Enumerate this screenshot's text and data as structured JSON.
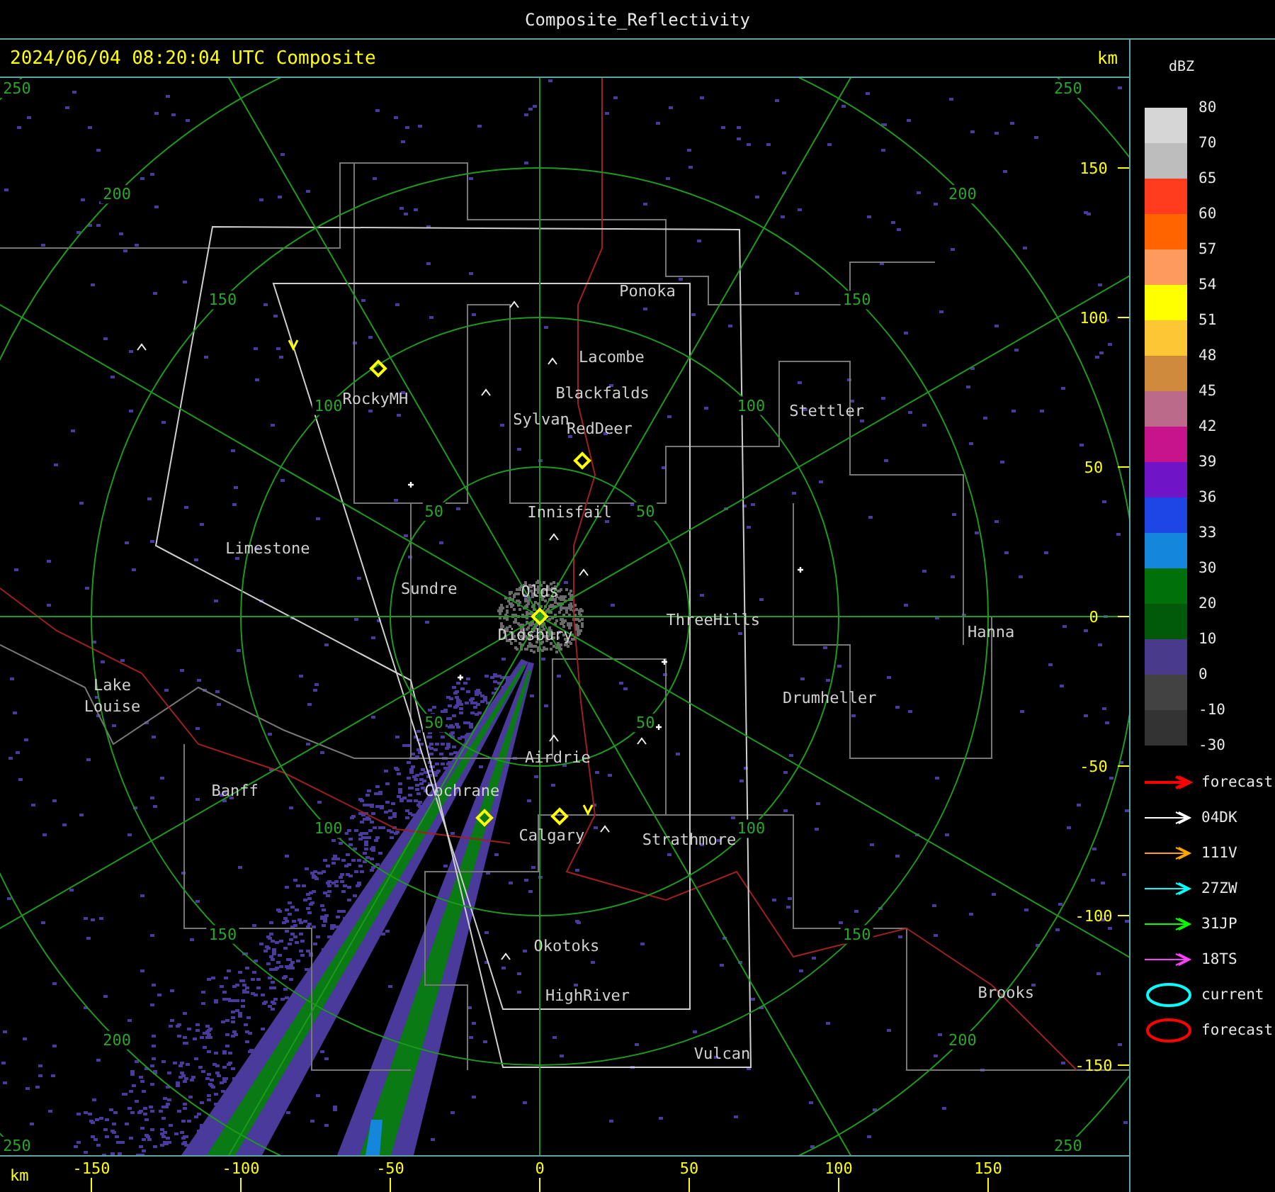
{
  "window": {
    "title": "Composite_Reflectivity"
  },
  "map": {
    "timestamp": "2024/06/04 08:20:04 UTC Composite",
    "unit": "km",
    "rings": [
      {
        "labels": [
          "50",
          "50",
          "50",
          "50"
        ]
      },
      {
        "labels": [
          "100",
          "100",
          "100",
          "100"
        ]
      },
      {
        "labels": [
          "150",
          "150",
          "150",
          "150"
        ]
      },
      {
        "labels": [
          "200",
          "200",
          "200",
          "200"
        ]
      },
      {
        "labels": [
          "250",
          "250",
          "250",
          "250"
        ]
      }
    ],
    "cities": [
      {
        "name": "Ponoka"
      },
      {
        "name": "Lacombe"
      },
      {
        "name": "Blackfalds"
      },
      {
        "name": "RedDeer"
      },
      {
        "name": "Sylvan"
      },
      {
        "name": "RockyMH"
      },
      {
        "name": "Stettler"
      },
      {
        "name": "Limestone"
      },
      {
        "name": "Innisfail"
      },
      {
        "name": "Sundre"
      },
      {
        "name": "Olds"
      },
      {
        "name": "Didsbury"
      },
      {
        "name": "ThreeHills"
      },
      {
        "name": "Hanna"
      },
      {
        "name": "Drumheller"
      },
      {
        "name": "Lake Louise"
      },
      {
        "name": "Banff"
      },
      {
        "name": "Cochrane"
      },
      {
        "name": "Airdrie"
      },
      {
        "name": "Calgary"
      },
      {
        "name": "Strathmore"
      },
      {
        "name": "Okotoks"
      },
      {
        "name": "HighRiver"
      },
      {
        "name": "Vulcan"
      },
      {
        "name": "Brooks"
      }
    ],
    "y_ticks": [
      "150",
      "100",
      "50",
      "0",
      "-50",
      "-100",
      "-150"
    ]
  },
  "x_axis": {
    "unit": "km",
    "ticks": [
      "-150",
      "-100",
      "-50",
      "0",
      "50",
      "100",
      "150"
    ]
  },
  "legend": {
    "unit": "dBZ",
    "levels": [
      {
        "label": "80",
        "color": "#d6d6d6"
      },
      {
        "label": "70",
        "color": "#bdbdbd"
      },
      {
        "label": "65",
        "color": "#ff3c1e"
      },
      {
        "label": "60",
        "color": "#ff6400"
      },
      {
        "label": "57",
        "color": "#ff9a5e"
      },
      {
        "label": "54",
        "color": "#ffff00"
      },
      {
        "label": "51",
        "color": "#fcc634"
      },
      {
        "label": "48",
        "color": "#d08a3e"
      },
      {
        "label": "45",
        "color": "#bc6a8a"
      },
      {
        "label": "42",
        "color": "#c8148c"
      },
      {
        "label": "39",
        "color": "#7014c8"
      },
      {
        "label": "36",
        "color": "#1e46e6"
      },
      {
        "label": "33",
        "color": "#1486dc"
      },
      {
        "label": "30",
        "color": "#00700a"
      },
      {
        "label": "20",
        "color": "#005a0a"
      },
      {
        "label": "10",
        "color": "#4a3a8c"
      },
      {
        "label": "0",
        "color": "#424242"
      },
      {
        "label": "-10",
        "color": "#333333"
      }
    ],
    "last_label": "-30",
    "tracks": [
      {
        "kind": "arrow",
        "label": "forecast",
        "color": "#ff0000"
      },
      {
        "kind": "arrow",
        "label": "04DK",
        "color": "#ffffff"
      },
      {
        "kind": "arrow",
        "label": "111V",
        "color": "#ffa500"
      },
      {
        "kind": "arrow",
        "label": "27ZW",
        "color": "#00ffff"
      },
      {
        "kind": "arrow",
        "label": "31JP",
        "color": "#00ff00"
      },
      {
        "kind": "arrow",
        "label": "18TS",
        "color": "#ff40ff"
      },
      {
        "kind": "ellipse",
        "label": "current",
        "color": "#00ffff"
      },
      {
        "kind": "ellipse",
        "label": "forecast",
        "color": "#ff0000"
      }
    ]
  }
}
